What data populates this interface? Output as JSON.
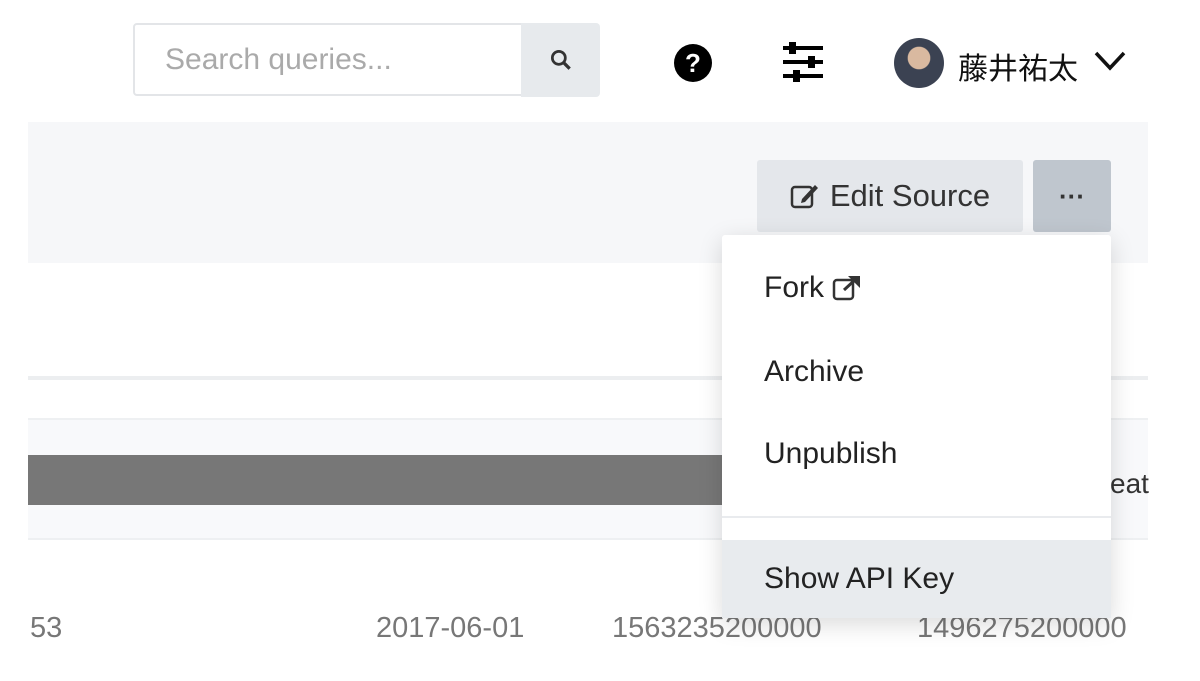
{
  "header": {
    "search_placeholder": "Search queries...",
    "user_name": "藤井祐太"
  },
  "toolbar": {
    "edit_label": "Edit Source",
    "more_label": "···"
  },
  "menu": {
    "items": [
      "Fork",
      "Archive",
      "Unpublish",
      "Show API Key"
    ]
  },
  "table": {
    "header_partial": "eat",
    "row": [
      "53",
      "2017-06-01",
      "1563235200000",
      "1496275200000"
    ]
  }
}
